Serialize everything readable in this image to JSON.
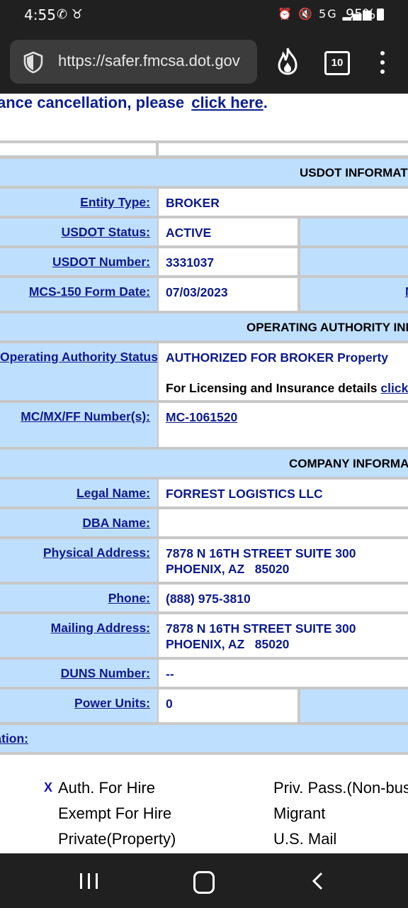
{
  "status_bar": {
    "time": "4:55",
    "left_icons": "✆ ♉",
    "right_icons": "⏰ 🔇 5G ▂▄▆",
    "battery": "95%"
  },
  "browser": {
    "url": "https://safer.fmcsa.dot.gov",
    "tab_count": "10",
    "icons": [
      "shield-icon",
      "flame-icon",
      "tabs-icon",
      "menu-icon"
    ]
  },
  "notice": {
    "text": "ance cancellation, please ",
    "link": "click here",
    "tail": "."
  },
  "sections": {
    "usdot": "USDOT INFORMATION",
    "operating": "OPERATING AUTHORITY INFORMATION",
    "company": "COMPANY INFORMATION"
  },
  "rows": {
    "entity_type": {
      "label": "Entity Type:",
      "value": "BROKER"
    },
    "usdot_status": {
      "label": "USDOT Status:",
      "value": "ACTIVE"
    },
    "usdot_number": {
      "label": "USDOT Number:",
      "value": "3331037"
    },
    "mcs150": {
      "label": "MCS-150 Form Date:",
      "value": "07/03/2023",
      "right_label": "M"
    },
    "op_status": {
      "label": "Operating Authority Status:",
      "value": "AUTHORIZED FOR BROKER Property",
      "detail": "For Licensing and Insurance details ",
      "detail_link": "click here"
    },
    "mc_number": {
      "label": "MC/MX/FF Number(s):",
      "value": "MC-1061520"
    },
    "legal_name": {
      "label": "Legal Name:",
      "value": "FORREST LOGISTICS LLC"
    },
    "dba_name": {
      "label": "DBA Name:",
      "value": ""
    },
    "physical_address": {
      "label": "Physical Address:",
      "line1": "7878 N 16TH STREET SUITE 300",
      "line2": "PHOENIX, AZ   85020"
    },
    "phone": {
      "label": "Phone:",
      "value": "(888) 975-3810"
    },
    "mailing_address": {
      "label": "Mailing Address:",
      "line1": "7878 N 16TH STREET SUITE 300",
      "line2": "PHOENIX, AZ   85020"
    },
    "duns": {
      "label": "DUNS Number:",
      "value": "--"
    },
    "power_units": {
      "label": "Power Units:",
      "value": "0"
    }
  },
  "classification": {
    "label": "Operation Classification:",
    "marker": "X",
    "left_items": [
      "Auth. For Hire",
      "Exempt For Hire",
      "Private(Property)"
    ],
    "right_items": [
      "Priv. Pass.(Non-business)",
      "Migrant",
      "U.S. Mail"
    ]
  }
}
